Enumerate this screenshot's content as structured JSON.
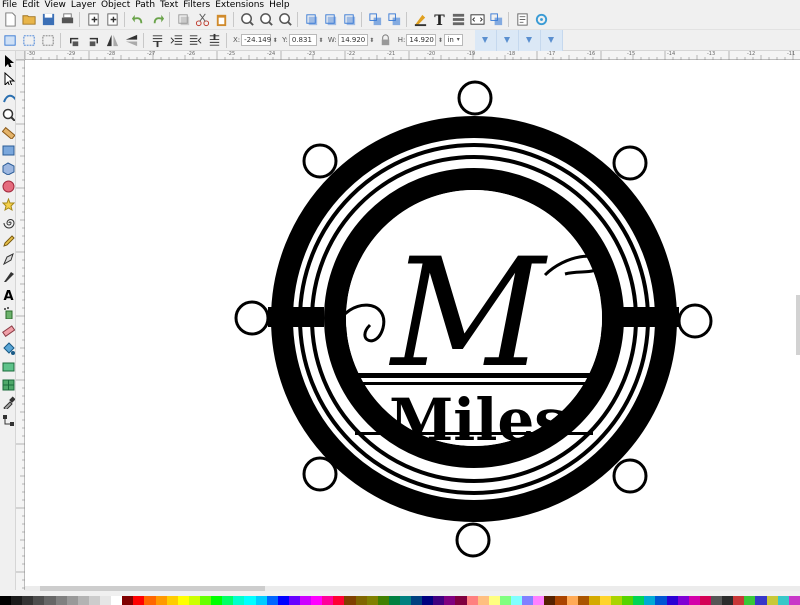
{
  "menu": [
    "File",
    "Edit",
    "View",
    "Layer",
    "Object",
    "Path",
    "Text",
    "Filters",
    "Extensions",
    "Help"
  ],
  "command_bar": [
    {
      "name": "new-doc-icon",
      "color": "#ffffff"
    },
    {
      "name": "open-icon",
      "color": "#e8b54a"
    },
    {
      "name": "save-icon",
      "color": "#3b6fb6"
    },
    {
      "name": "print-icon",
      "color": "#555555"
    },
    {
      "sep": true
    },
    {
      "name": "import-icon",
      "color": "#333333"
    },
    {
      "name": "export-icon",
      "color": "#333333"
    },
    {
      "sep": true
    },
    {
      "name": "undo-icon",
      "color": "#6aa34a"
    },
    {
      "name": "redo-icon",
      "color": "#6aa34a"
    },
    {
      "sep": true
    },
    {
      "name": "copy-icon",
      "color": "#999999"
    },
    {
      "name": "cut-icon",
      "color": "#c0392b"
    },
    {
      "name": "paste-icon",
      "color": "#d08b2c"
    },
    {
      "sep": true
    },
    {
      "name": "zoom-selection-icon",
      "color": "#555555"
    },
    {
      "name": "zoom-drawing-icon",
      "color": "#555555"
    },
    {
      "name": "zoom-page-icon",
      "color": "#555555"
    },
    {
      "sep": true
    },
    {
      "name": "duplicate-icon",
      "color": "#3a7bd5"
    },
    {
      "name": "clone-icon",
      "color": "#3a7bd5"
    },
    {
      "name": "unlink-clone-icon",
      "color": "#3a7bd5"
    },
    {
      "sep": true
    },
    {
      "name": "group-icon",
      "color": "#3a7bd5"
    },
    {
      "name": "ungroup-icon",
      "color": "#3a7bd5"
    },
    {
      "sep": true
    },
    {
      "name": "fill-stroke-icon",
      "color": "#e0a020"
    },
    {
      "name": "text-font-icon",
      "color": "#222222"
    },
    {
      "name": "layers-icon",
      "color": "#666666"
    },
    {
      "name": "xml-editor-icon",
      "color": "#333333"
    },
    {
      "name": "align-distribute-icon",
      "color": "#3a7bd5"
    },
    {
      "sep": true
    },
    {
      "name": "document-properties-icon",
      "color": "#666666"
    },
    {
      "name": "preferences-icon",
      "color": "#3a9bd5"
    }
  ],
  "controls": {
    "x_label": "X:",
    "x_value": "-24.149",
    "y_label": "Y:",
    "y_value": "0.831",
    "w_label": "W:",
    "w_value": "14.920",
    "h_label": "H:",
    "h_value": "14.920",
    "unit": "in"
  },
  "tools": [
    "selector-tool-icon",
    "node-tool-icon",
    "tweak-tool-icon",
    "zoom-tool-icon",
    "measure-tool-icon",
    "rectangle-tool-icon",
    "3d-box-tool-icon",
    "ellipse-tool-icon",
    "star-tool-icon",
    "spiral-tool-icon",
    "pencil-tool-icon",
    "pen-tool-icon",
    "calligraphy-tool-icon",
    "text-tool-icon",
    "spray-tool-icon",
    "eraser-tool-icon",
    "paint-bucket-tool-icon",
    "gradient-tool-icon",
    "mesh-tool-icon",
    "dropper-tool-icon",
    "connector-tool-icon"
  ],
  "ruler_ticks": [
    "-30",
    "-29",
    "-28",
    "-27",
    "-26",
    "-25",
    "-24",
    "-23",
    "-22",
    "-21",
    "-20",
    "-19",
    "-18",
    "-17",
    "-16",
    "-15",
    "-14",
    "-13",
    "-12",
    "-11"
  ],
  "drawing": {
    "monogram": "M",
    "name": "Miles"
  },
  "palette": [
    "#000000",
    "#1a1a1a",
    "#333333",
    "#4d4d4d",
    "#666666",
    "#808080",
    "#999999",
    "#b3b3b3",
    "#cccccc",
    "#e6e6e6",
    "#ffffff",
    "#800000",
    "#ff0000",
    "#ff6600",
    "#ff9900",
    "#ffcc00",
    "#ffff00",
    "#ccff00",
    "#66ff00",
    "#00ff00",
    "#00ff66",
    "#00ffcc",
    "#00ffff",
    "#00ccff",
    "#0066ff",
    "#0000ff",
    "#6600ff",
    "#cc00ff",
    "#ff00ff",
    "#ff0099",
    "#ff0033",
    "#804000",
    "#806600",
    "#808000",
    "#408000",
    "#008040",
    "#008080",
    "#004080",
    "#000080",
    "#400080",
    "#800080",
    "#800040",
    "#ff8080",
    "#ffbf80",
    "#ffff80",
    "#80ff80",
    "#80ffff",
    "#8080ff",
    "#ff80ff",
    "#552200",
    "#aa4400",
    "#ffaa55",
    "#aa5500",
    "#d4aa00",
    "#ffd42a",
    "#aad400",
    "#55d400",
    "#00d455",
    "#00aad4",
    "#0055d4",
    "#2a00d4",
    "#7f00d4",
    "#d400aa",
    "#d40055",
    "#555555",
    "#2b2b2b",
    "#c83737",
    "#37c837",
    "#3737c8",
    "#c8c837",
    "#37c8c8",
    "#c837c8"
  ]
}
